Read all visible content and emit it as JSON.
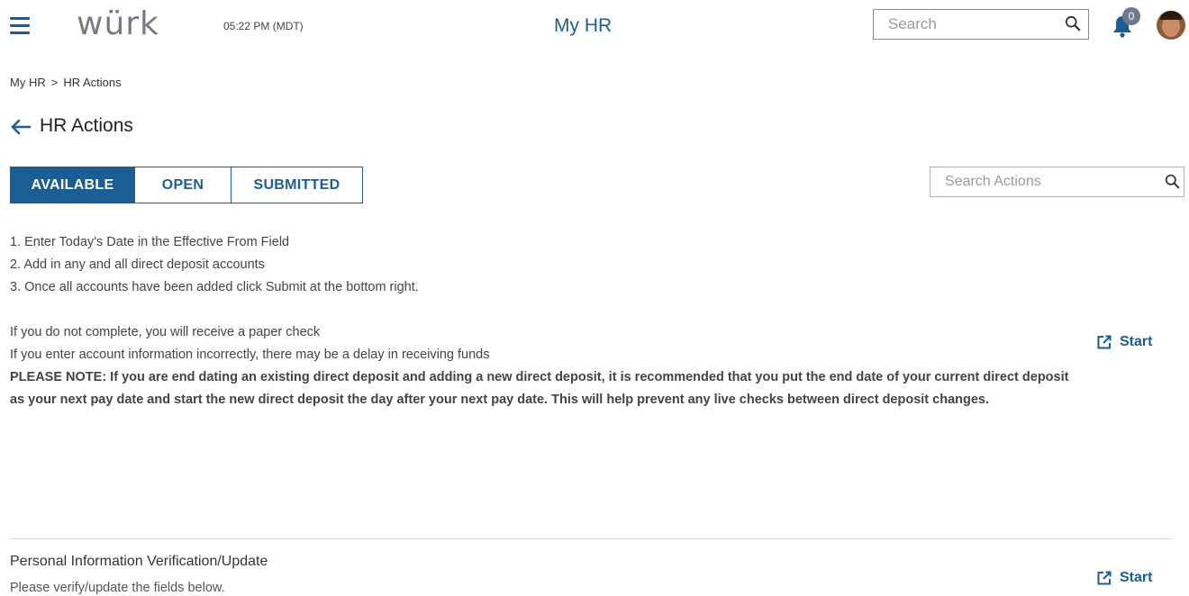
{
  "header": {
    "logo": "würk",
    "time": "05:22 PM (MDT)",
    "app_title": "My HR",
    "search_placeholder": "Search",
    "notification_count": "0"
  },
  "breadcrumb": {
    "items": [
      "My HR",
      "HR Actions"
    ],
    "separator": ">"
  },
  "page": {
    "title": "HR Actions"
  },
  "tabs": [
    {
      "label": "AVAILABLE",
      "active": true
    },
    {
      "label": "OPEN",
      "active": false
    },
    {
      "label": "SUBMITTED",
      "active": false
    }
  ],
  "actions_search": {
    "placeholder": "Search Actions"
  },
  "actions": [
    {
      "lines": [
        "1. Enter Today's Date in the Effective From Field",
        "2. Add in any and all direct deposit accounts",
        "3. Once all accounts have been added click Submit at the bottom right."
      ],
      "notes": [
        "If you do not complete, you will receive a paper check",
        "If you enter account information incorrectly, there may be a delay in receiving funds"
      ],
      "bold_note": "PLEASE NOTE: If you are end dating an existing direct deposit and adding a new direct deposit, it is recommended that you put the end date of your current direct deposit as your next pay date and start the new direct deposit the day after your next pay date. This will help prevent any live checks between direct deposit changes.",
      "start_label": "Start"
    },
    {
      "title": "Personal Information Verification/Update",
      "description": "Please verify/update the fields below.",
      "start_label": "Start"
    }
  ],
  "colors": {
    "brand": "#1a5e94",
    "logo": "#7a7a86",
    "badge": "#6b7b8c"
  },
  "icons": {
    "menu": "hamburger-icon",
    "search": "search-icon",
    "notifications": "bell-icon",
    "back": "back-arrow-icon",
    "start": "external-link-icon"
  }
}
